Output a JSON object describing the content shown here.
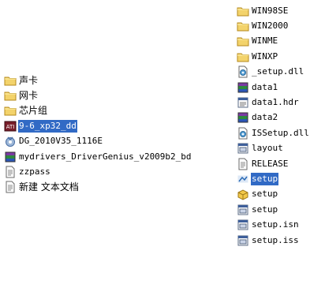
{
  "left_list": {
    "items": [
      {
        "label": "声卡",
        "icon": "folder-icon",
        "selected": false
      },
      {
        "label": "网卡",
        "icon": "folder-icon",
        "selected": false
      },
      {
        "label": "芯片组",
        "icon": "folder-icon",
        "selected": false
      },
      {
        "label": "9-6_xp32_dd",
        "icon": "ati-driver-icon",
        "selected": true
      },
      {
        "label": "DG_2010V35_1116E",
        "icon": "driver-genius-icon",
        "selected": false
      },
      {
        "label": "mydrivers_DriverGenius_v2009b2_bd",
        "icon": "winrar-archive-icon",
        "selected": false
      },
      {
        "label": "zzpass",
        "icon": "text-file-icon",
        "selected": false
      },
      {
        "label": "新建 文本文档",
        "icon": "text-file-icon",
        "selected": false
      }
    ]
  },
  "right_list": {
    "items": [
      {
        "label": "WIN98SE",
        "icon": "folder-icon",
        "selected": false
      },
      {
        "label": "WIN2000",
        "icon": "folder-icon",
        "selected": false
      },
      {
        "label": "WINME",
        "icon": "folder-icon",
        "selected": false
      },
      {
        "label": "WINXP",
        "icon": "folder-icon",
        "selected": false
      },
      {
        "label": "_setup.dll",
        "icon": "dll-file-icon",
        "selected": false
      },
      {
        "label": "data1",
        "icon": "winrar-archive-icon",
        "selected": false
      },
      {
        "label": "data1.hdr",
        "icon": "hdr-file-icon",
        "selected": false
      },
      {
        "label": "data2",
        "icon": "winrar-archive-icon",
        "selected": false
      },
      {
        "label": "ISSetup.dll",
        "icon": "dll-file-icon",
        "selected": false
      },
      {
        "label": "layout",
        "icon": "binary-file-icon",
        "selected": false
      },
      {
        "label": "RELEASE",
        "icon": "text-file-icon",
        "selected": false
      },
      {
        "label": "setup",
        "icon": "setup-exe-icon",
        "selected": true
      },
      {
        "label": "setup",
        "icon": "setup-package-icon",
        "selected": false
      },
      {
        "label": "setup",
        "icon": "binary-file-icon",
        "selected": false
      },
      {
        "label": "setup.isn",
        "icon": "binary-file-icon",
        "selected": false
      },
      {
        "label": "setup.iss",
        "icon": "binary-file-icon",
        "selected": false
      }
    ]
  },
  "colors": {
    "selection": "#316ac5",
    "folder": "#f3d36b"
  }
}
